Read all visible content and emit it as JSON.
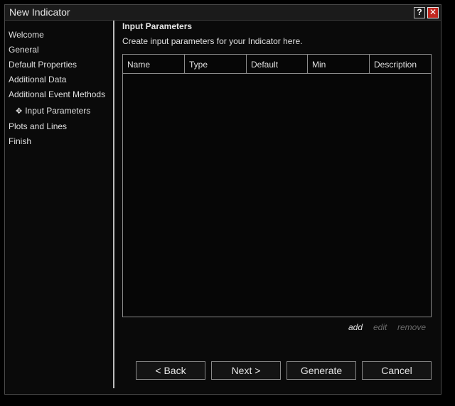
{
  "window": {
    "title": "New Indicator",
    "help_label": "?",
    "close_label": "✕"
  },
  "sidebar": {
    "items": [
      {
        "label": "Welcome"
      },
      {
        "label": "General"
      },
      {
        "label": "Default Properties"
      },
      {
        "label": "Additional Data"
      },
      {
        "label": "Additional Event Methods"
      },
      {
        "label": "Input Parameters",
        "marker": "✥",
        "active": true
      },
      {
        "label": "Plots and Lines"
      },
      {
        "label": "Finish"
      }
    ]
  },
  "main": {
    "heading": "Input Parameters",
    "description": "Create input parameters for your Indicator here.",
    "grid": {
      "columns": [
        "Name",
        "Type",
        "Default",
        "Min",
        "Description"
      ],
      "rows": []
    },
    "actions": {
      "add": "add",
      "edit": "edit",
      "remove": "remove"
    }
  },
  "footer": {
    "back": "< Back",
    "next": "Next >",
    "generate": "Generate",
    "cancel": "Cancel"
  }
}
